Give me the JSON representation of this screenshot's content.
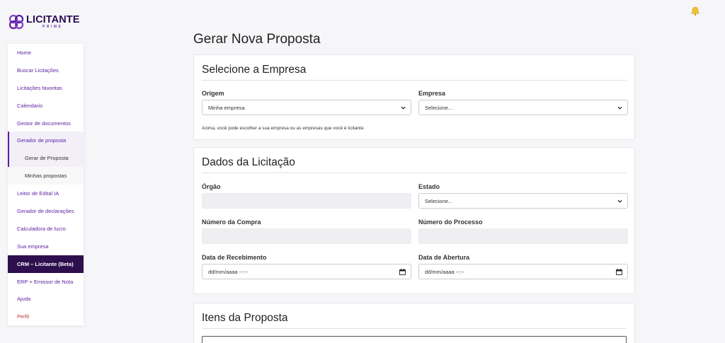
{
  "app": {
    "logo_title": "LICITANTE",
    "logo_sub": "PRIME",
    "brand_color": "#5a1fa0",
    "dark_color": "#2d0f4e"
  },
  "sidebar": {
    "items": [
      {
        "label": "Home"
      },
      {
        "label": "Buscar Licitações"
      },
      {
        "label": "Licitações favoritas"
      },
      {
        "label": "Calendario"
      },
      {
        "label": "Gestor de documentos"
      },
      {
        "label": "Gerador de proposta"
      },
      {
        "label": "Gerar de Proposta"
      },
      {
        "label": "Minhas propostas"
      },
      {
        "label": "Leitor de Edital IA"
      },
      {
        "label": "Gerador de declarações"
      },
      {
        "label": "Calculadora de lucro"
      },
      {
        "label": "Sua empresa"
      },
      {
        "label": "CRM – Licitante (Beta)"
      },
      {
        "label": "ERP + Emissor de Nota"
      },
      {
        "label": "Ajuda"
      },
      {
        "label": "Perfil"
      }
    ]
  },
  "page": {
    "title": "Gerar Nova Proposta"
  },
  "empresa_card": {
    "title": "Selecione a Empresa",
    "origem_label": "Origem",
    "origem_value": "Minha empresa",
    "empresa_label": "Empresa",
    "empresa_value": "Selecione...",
    "hint": "Acima, você pode escolher a sua empresa ou as empresas que você é licitante."
  },
  "licitacao_card": {
    "title": "Dados da Licitação",
    "orgao_label": "Órgão",
    "orgao_value": "",
    "estado_label": "Estado",
    "estado_value": "Selecione...",
    "numero_compra_label": "Número da Compra",
    "numero_compra_value": "",
    "numero_processo_label": "Número do Processo",
    "numero_processo_value": "",
    "data_recebimento_label": "Data de Recebimento",
    "data_recebimento_value": "dd/mm/aaaa --:--",
    "data_abertura_label": "Data de Abertura",
    "data_abertura_value": "dd/mm/aaaa --:--"
  },
  "itens_card": {
    "title": "Itens da Proposta"
  }
}
